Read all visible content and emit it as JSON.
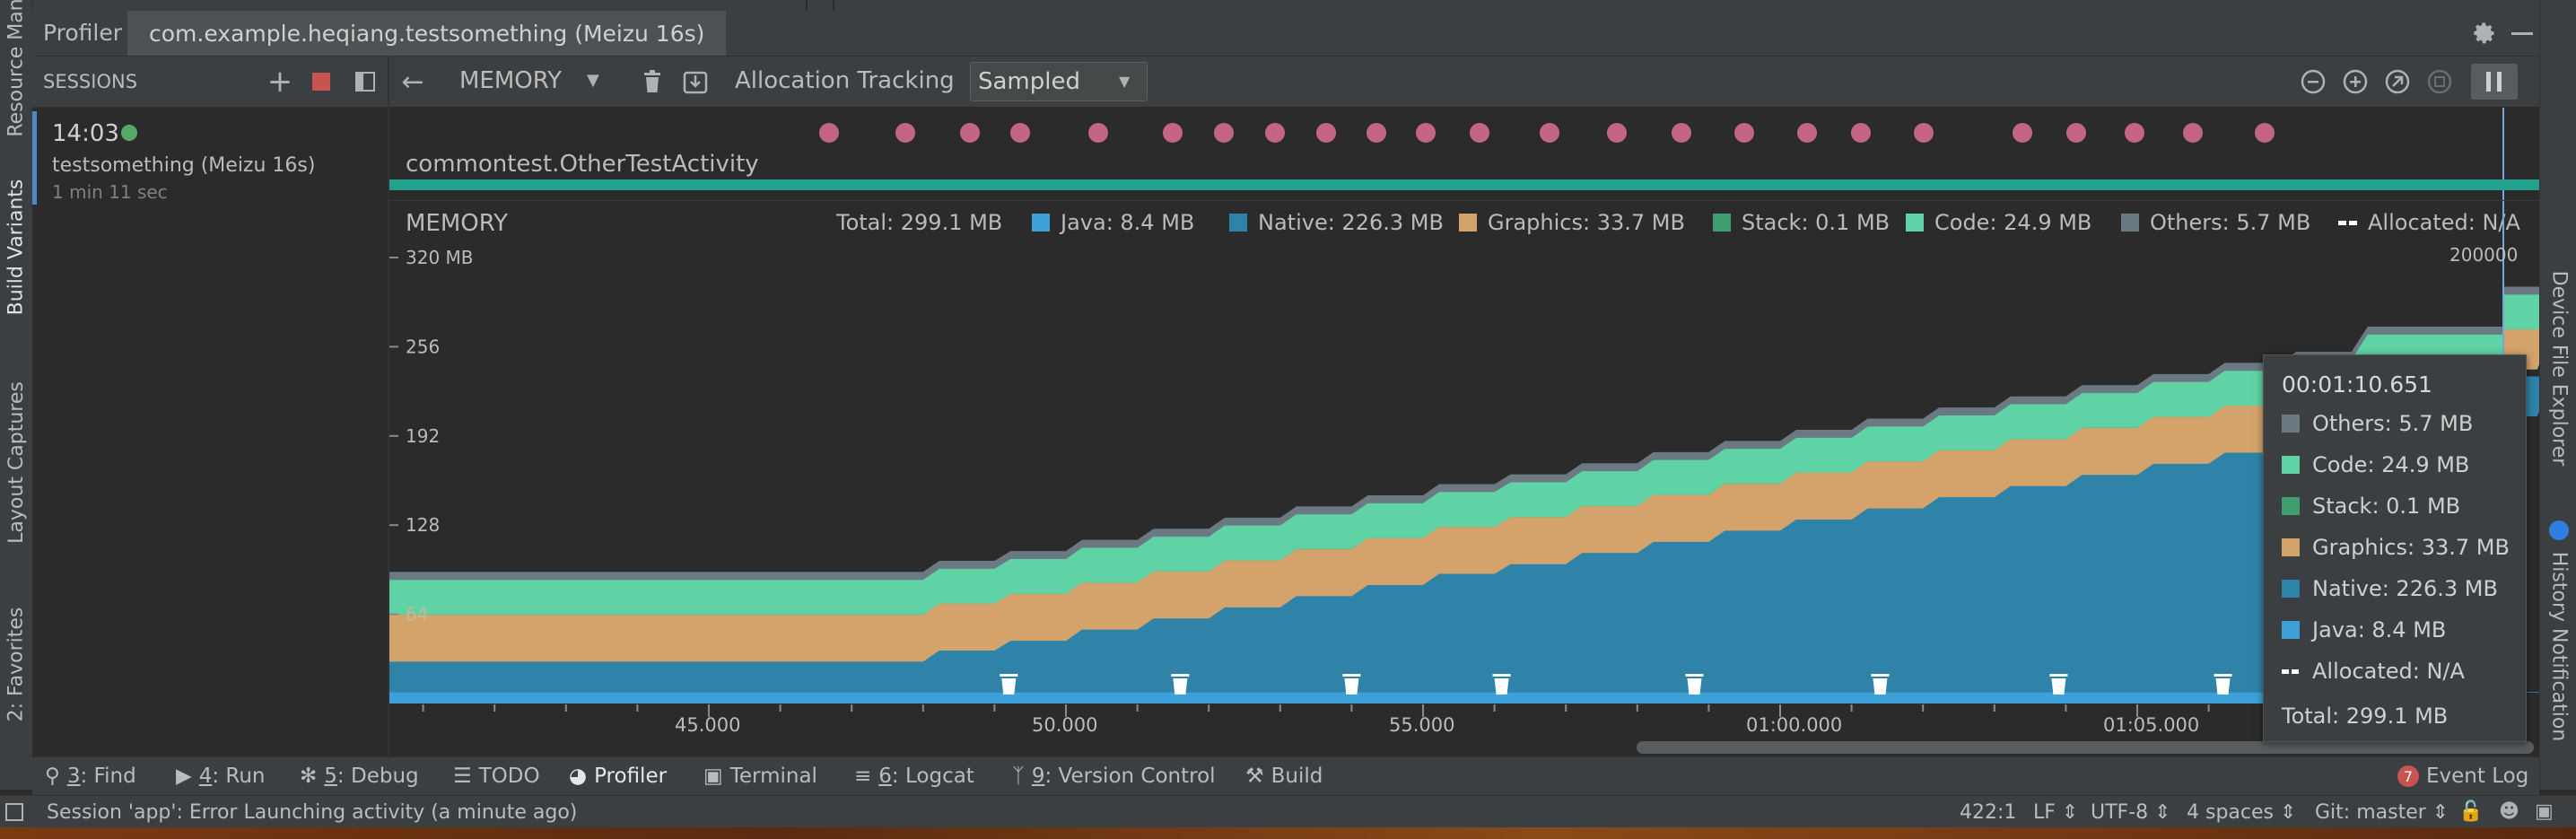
{
  "header": {
    "profiler_tab": "Profiler",
    "session_tab": "com.example.heqiang.testsomething (Meizu 16s)"
  },
  "left_strip": {
    "tabs": [
      "Resource Manager",
      "Build Variants",
      "Layout Captures",
      "2: Favorites"
    ]
  },
  "right_strip": {
    "tabs": [
      "Device File Explorer",
      "History Notification"
    ]
  },
  "sessions": {
    "title": "SESSIONS",
    "item": {
      "time": "14:03",
      "name": "testsomething (Meizu 16s)",
      "duration": "1 min 11 sec"
    }
  },
  "toolbar": {
    "profiler_name": "MEMORY",
    "allocation_label": "Allocation Tracking",
    "allocation_mode": "Sampled"
  },
  "events": {
    "activity_name": "commontest.OtherTestActivity"
  },
  "memory_chart": {
    "title": "MEMORY",
    "total_label": "Total: 299.1 MB",
    "legend": [
      {
        "label": "Java: 8.4 MB",
        "color": "#3ea0d8"
      },
      {
        "label": "Native: 226.3 MB",
        "color": "#2f82a8"
      },
      {
        "label": "Graphics: 33.7 MB",
        "color": "#d4a36c"
      },
      {
        "label": "Stack: 0.1 MB",
        "color": "#3f9c6e"
      },
      {
        "label": "Code: 24.9 MB",
        "color": "#5fd3a5"
      },
      {
        "label": "Others: 5.7 MB",
        "color": "#6b7a82"
      },
      {
        "label": "Allocated: N/A",
        "color": "#ffffff"
      }
    ],
    "right_axis_top": "200000"
  },
  "chart_data": {
    "type": "area",
    "title": "MEMORY",
    "yunit": "MB",
    "ylim": [
      0,
      320
    ],
    "y_ticks": [
      "320 MB",
      "256",
      "192",
      "128",
      "64"
    ],
    "x_ticks": [
      "45.000",
      "50.000",
      "55.000",
      "01:00.000",
      "01:05.000"
    ],
    "x": [
      41,
      47,
      48,
      49,
      50,
      51,
      52,
      53,
      54,
      55,
      56,
      57,
      58,
      59,
      60,
      61,
      62,
      63,
      64,
      65,
      66,
      67,
      68,
      70.6
    ],
    "series": [
      {
        "name": "Java",
        "color": "#3ea0d8",
        "values": [
          8,
          8,
          8,
          8,
          8,
          8,
          8,
          8,
          8,
          8,
          8,
          8,
          8,
          8,
          8,
          8,
          8,
          8,
          8,
          8,
          8,
          8,
          8,
          8.4
        ]
      },
      {
        "name": "Native",
        "color": "#2f82a8",
        "values": [
          22,
          22,
          30,
          37,
          45,
          53,
          61,
          69,
          77,
          85,
          92,
          100,
          108,
          116,
          124,
          132,
          140,
          148,
          156,
          164,
          172,
          180,
          198,
          226.3
        ]
      },
      {
        "name": "Graphics",
        "color": "#d4a36c",
        "values": [
          33.7,
          33.7,
          33.7,
          33.7,
          33.7,
          33.7,
          33.7,
          33.7,
          33.7,
          33.7,
          33.7,
          33.7,
          33.7,
          33.7,
          33.7,
          33.7,
          33.7,
          33.7,
          33.7,
          33.7,
          33.7,
          33.7,
          33.7,
          33.7
        ]
      },
      {
        "name": "Stack",
        "color": "#3f9c6e",
        "values": [
          0.1,
          0.1,
          0.1,
          0.1,
          0.1,
          0.1,
          0.1,
          0.1,
          0.1,
          0.1,
          0.1,
          0.1,
          0.1,
          0.1,
          0.1,
          0.1,
          0.1,
          0.1,
          0.1,
          0.1,
          0.1,
          0.1,
          0.1,
          0.1
        ]
      },
      {
        "name": "Code",
        "color": "#5fd3a5",
        "values": [
          24.9,
          24.9,
          24.9,
          24.9,
          24.9,
          24.9,
          24.9,
          24.9,
          24.9,
          24.9,
          24.9,
          24.9,
          24.9,
          24.9,
          24.9,
          24.9,
          24.9,
          24.9,
          24.9,
          24.9,
          24.9,
          24.9,
          24.9,
          24.9
        ]
      },
      {
        "name": "Others",
        "color": "#6b7a82",
        "values": [
          5.7,
          5.7,
          5.7,
          5.7,
          5.7,
          5.7,
          5.7,
          5.7,
          5.7,
          5.7,
          5.7,
          5.7,
          5.7,
          5.7,
          5.7,
          5.7,
          5.7,
          5.7,
          5.7,
          5.7,
          5.7,
          5.7,
          5.7,
          5.7
        ]
      }
    ],
    "gc_events_x": [
      49.2,
      51.6,
      54.0,
      56.1,
      58.8,
      61.4,
      63.9,
      66.2
    ]
  },
  "tooltip": {
    "time": "00:01:10.651",
    "rows": [
      {
        "label": "Others: 5.7 MB",
        "color": "#6b7a82"
      },
      {
        "label": "Code: 24.9 MB",
        "color": "#5fd3a5"
      },
      {
        "label": "Stack: 0.1 MB",
        "color": "#3f9c6e"
      },
      {
        "label": "Graphics: 33.7 MB",
        "color": "#d4a36c"
      },
      {
        "label": "Native: 226.3 MB",
        "color": "#2f82a8"
      },
      {
        "label": "Java: 8.4 MB",
        "color": "#3ea0d8"
      },
      {
        "label": "Allocated: N/A",
        "color": "#ffffff"
      }
    ],
    "total": "Total: 299.1 MB"
  },
  "bottom_bar": {
    "find": {
      "num": "3",
      "rest": ": Find"
    },
    "run": {
      "num": "4",
      "rest": ": Run"
    },
    "debug": {
      "num": "5",
      "rest": ": Debug"
    },
    "todo": "TODO",
    "profiler": "Profiler",
    "terminal": "Terminal",
    "logcat": {
      "num": "6",
      "rest": ": Logcat"
    },
    "vcs": {
      "num": "9",
      "rest": ": Version Control"
    },
    "build": "Build",
    "event_log_count": "7",
    "event_log": "Event Log"
  },
  "status_bar": {
    "message": "Session 'app': Error Launching activity (a minute ago)",
    "position": "422:1",
    "line_sep": "LF",
    "encoding": "UTF-8",
    "indent": "4 spaces",
    "git": "Git: master"
  }
}
